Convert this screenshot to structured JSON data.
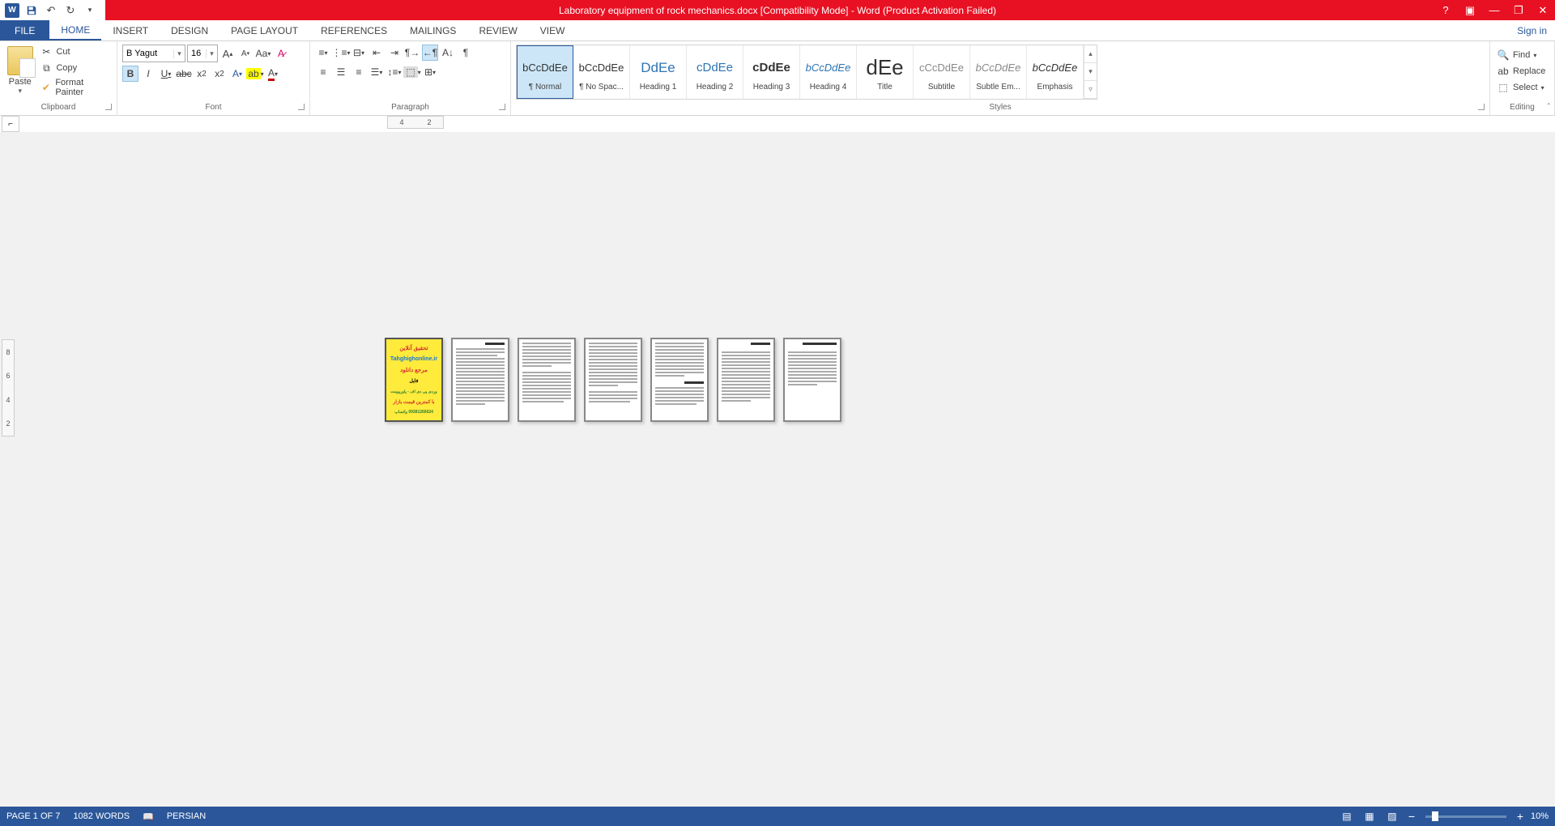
{
  "titlebar": {
    "title": "Laboratory equipment of rock mechanics.docx [Compatibility Mode] - Word (Product Activation Failed)"
  },
  "tabs": {
    "file": "FILE",
    "items": [
      "HOME",
      "INSERT",
      "DESIGN",
      "PAGE LAYOUT",
      "REFERENCES",
      "MAILINGS",
      "REVIEW",
      "VIEW"
    ],
    "active": "HOME",
    "signin": "Sign in"
  },
  "clipboard": {
    "paste": "Paste",
    "cut": "Cut",
    "copy": "Copy",
    "format_painter": "Format Painter",
    "label": "Clipboard"
  },
  "font": {
    "name": "B Yagut",
    "size": "16",
    "label": "Font"
  },
  "paragraph": {
    "label": "Paragraph"
  },
  "ruler": {
    "marks": [
      "4",
      "2"
    ],
    "vmarks": [
      "2",
      "4",
      "6",
      "8"
    ]
  },
  "styles": {
    "label": "Styles",
    "items": [
      {
        "preview": "bCcDdEe",
        "name": "¶ Normal",
        "cls": ""
      },
      {
        "preview": "bCcDdEe",
        "name": "¶ No Spac...",
        "cls": ""
      },
      {
        "preview": "DdEe",
        "name": "Heading 1",
        "cls": "color:#2e74b5;font-size:17px"
      },
      {
        "preview": "cDdEe",
        "name": "Heading 2",
        "cls": "color:#2e74b5;font-size:15px"
      },
      {
        "preview": "cDdEe",
        "name": "Heading 3",
        "cls": "font-weight:bold;font-size:15px"
      },
      {
        "preview": "bCcDdEe",
        "name": "Heading 4",
        "cls": "color:#2e74b5;font-style:italic"
      },
      {
        "preview": "dEe",
        "name": "Title",
        "cls": "font-size:26px"
      },
      {
        "preview": "cCcDdEe",
        "name": "Subtitle",
        "cls": "color:#888"
      },
      {
        "preview": "bCcDdEe",
        "name": "Subtle Em...",
        "cls": "color:#888;font-style:italic"
      },
      {
        "preview": "bCcDdEe",
        "name": "Emphasis",
        "cls": "font-style:italic"
      }
    ]
  },
  "editing": {
    "find": "Find",
    "replace": "Replace",
    "select": "Select",
    "label": "Editing"
  },
  "cover": {
    "line1": "تحقیق آنلاین",
    "line2": "Tahghighonline.ir",
    "line3": "مرجع دانلود",
    "line4": "فایل",
    "line5": "وردی پی دی اف - پاورپوینت",
    "line6": "با کمترین قیمت بازار",
    "line7": "09381266624 واتساپ"
  },
  "status": {
    "page": "PAGE 1 OF 7",
    "words": "1082 WORDS",
    "lang": "PERSIAN",
    "zoom": "10%"
  }
}
